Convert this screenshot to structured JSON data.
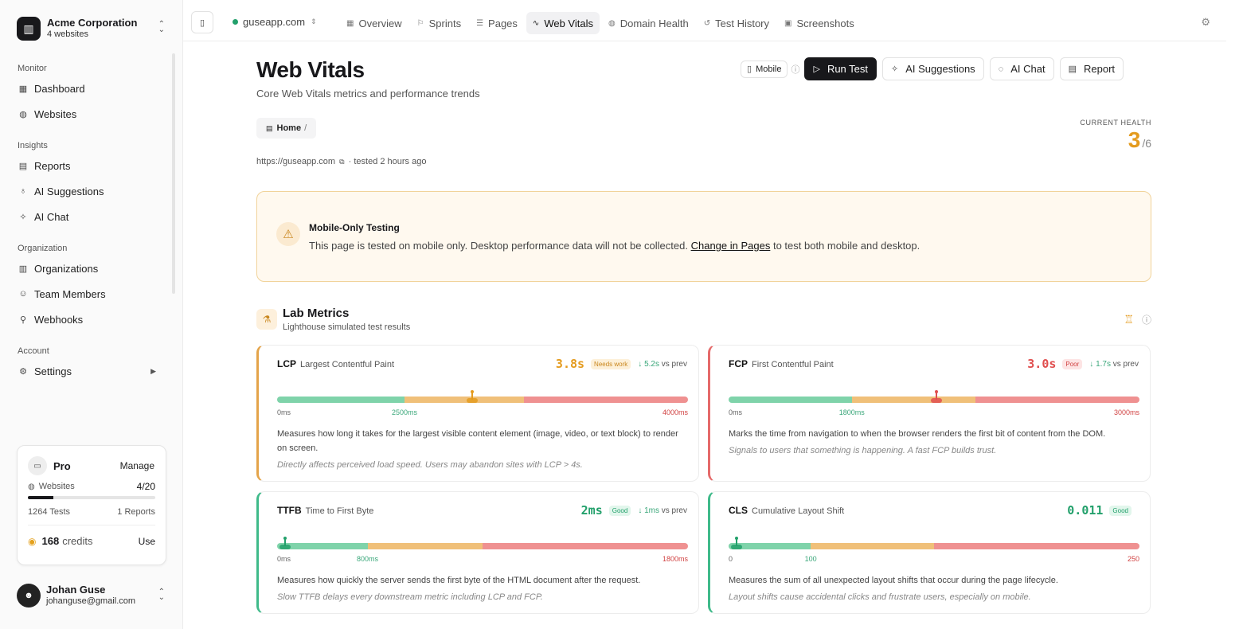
{
  "sidebar": {
    "org": {
      "name": "Acme Corporation",
      "sub": "4 websites"
    },
    "sections": [
      {
        "title": "Monitor",
        "items": [
          {
            "label": "Dashboard",
            "icon": "grid-icon"
          },
          {
            "label": "Websites",
            "icon": "globe-icon"
          }
        ]
      },
      {
        "title": "Insights",
        "items": [
          {
            "label": "Reports",
            "icon": "file-icon"
          },
          {
            "label": "AI Suggestions",
            "icon": "bulb-icon"
          },
          {
            "label": "AI Chat",
            "icon": "sparkle-icon"
          }
        ]
      },
      {
        "title": "Organization",
        "items": [
          {
            "label": "Organizations",
            "icon": "building-icon"
          },
          {
            "label": "Team Members",
            "icon": "users-icon"
          },
          {
            "label": "Webhooks",
            "icon": "webhook-icon"
          }
        ]
      },
      {
        "title": "Account",
        "items": [
          {
            "label": "Settings",
            "icon": "gear-icon"
          }
        ]
      }
    ],
    "plan": {
      "name": "Pro",
      "manage": "Manage",
      "websites_label": "Websites",
      "websites_value": "4/20",
      "websites_used": 4,
      "websites_limit": 20,
      "tests": "1264 Tests",
      "reports": "1 Reports",
      "credits_value": "168",
      "credits_label": "credits",
      "use": "Use"
    },
    "user": {
      "name": "Johan Guse",
      "email": "johanguse@gmail.com"
    }
  },
  "topbar": {
    "site": "guseapp.com",
    "tabs": [
      {
        "label": "Overview",
        "icon": "grid-icon"
      },
      {
        "label": "Sprints",
        "icon": "flag-icon"
      },
      {
        "label": "Pages",
        "icon": "list-icon"
      },
      {
        "label": "Web Vitals",
        "icon": "pulse-icon"
      },
      {
        "label": "Domain Health",
        "icon": "globe-icon"
      },
      {
        "label": "Test History",
        "icon": "history-icon"
      },
      {
        "label": "Screenshots",
        "icon": "image-icon"
      }
    ],
    "active_tab": "Web Vitals"
  },
  "page": {
    "title": "Web Vitals",
    "subtitle": "Core Web Vitals metrics and performance trends",
    "actions": {
      "mobile": "Mobile",
      "run": "Run Test",
      "suggestions": "AI Suggestions",
      "chat": "AI Chat",
      "report": "Report"
    },
    "breadcrumb": {
      "home": "Home",
      "sep": "/"
    },
    "url": "https://guseapp.com",
    "tested": "· tested 2 hours ago",
    "health": {
      "label": "CURRENT HEALTH",
      "value": "3",
      "total": "/6"
    }
  },
  "notice": {
    "title": "Mobile-Only Testing",
    "text_before": "This page is tested on mobile only. Desktop performance data will not be collected.",
    "link": "Change in Pages",
    "text_after": "to test both mobile and desktop."
  },
  "lab": {
    "title": "Lab Metrics",
    "subtitle": "Lighthouse simulated test results"
  },
  "metrics": [
    {
      "abbr": "LCP",
      "name": "Largest Contentful Paint",
      "value": "3.8s",
      "status": "Needs work",
      "delta": "↓ 5.2s",
      "delta_suffix": "vs prev",
      "ticks": [
        "0ms",
        "2500ms",
        "4000ms"
      ],
      "position": 0.475,
      "color": "#e49b1e",
      "desc": "Measures how long it takes for the largest visible content element (image, video, or text block) to render on screen.",
      "note": "Directly affects perceived load speed. Users may abandon sites with LCP > 4s."
    },
    {
      "abbr": "FCP",
      "name": "First Contentful Paint",
      "value": "3.0s",
      "status": "Poor",
      "delta": "↓ 1.7s",
      "delta_suffix": "vs prev",
      "ticks": [
        "0ms",
        "1800ms",
        "3000ms"
      ],
      "position": 0.505,
      "color": "#e04f4f",
      "desc": "Marks the time from navigation to when the browser renders the first bit of content from the DOM.",
      "note": "Signals to users that something is happening. A fast FCP builds trust."
    },
    {
      "abbr": "TTFB",
      "name": "Time to First Byte",
      "value": "2ms",
      "status": "Good",
      "delta": "↓ 1ms",
      "delta_suffix": "vs prev",
      "ticks": [
        "0ms",
        "800ms",
        "1800ms"
      ],
      "position": 0.02,
      "color": "#22a06b",
      "desc": "Measures how quickly the server sends the first byte of the HTML document after the request.",
      "note": "Slow TTFB delays every downstream metric including LCP and FCP."
    },
    {
      "abbr": "CLS",
      "name": "Cumulative Layout Shift",
      "value": "0.011",
      "status": "Good",
      "delta": "",
      "delta_suffix": "",
      "ticks": [
        "0",
        "100",
        "250"
      ],
      "position": 0.02,
      "color": "#22a06b",
      "desc": "Measures the sum of all unexpected layout shifts that occur during the page lifecycle.",
      "note": "Layout shifts cause accidental clicks and frustrate users, especially on mobile."
    }
  ]
}
